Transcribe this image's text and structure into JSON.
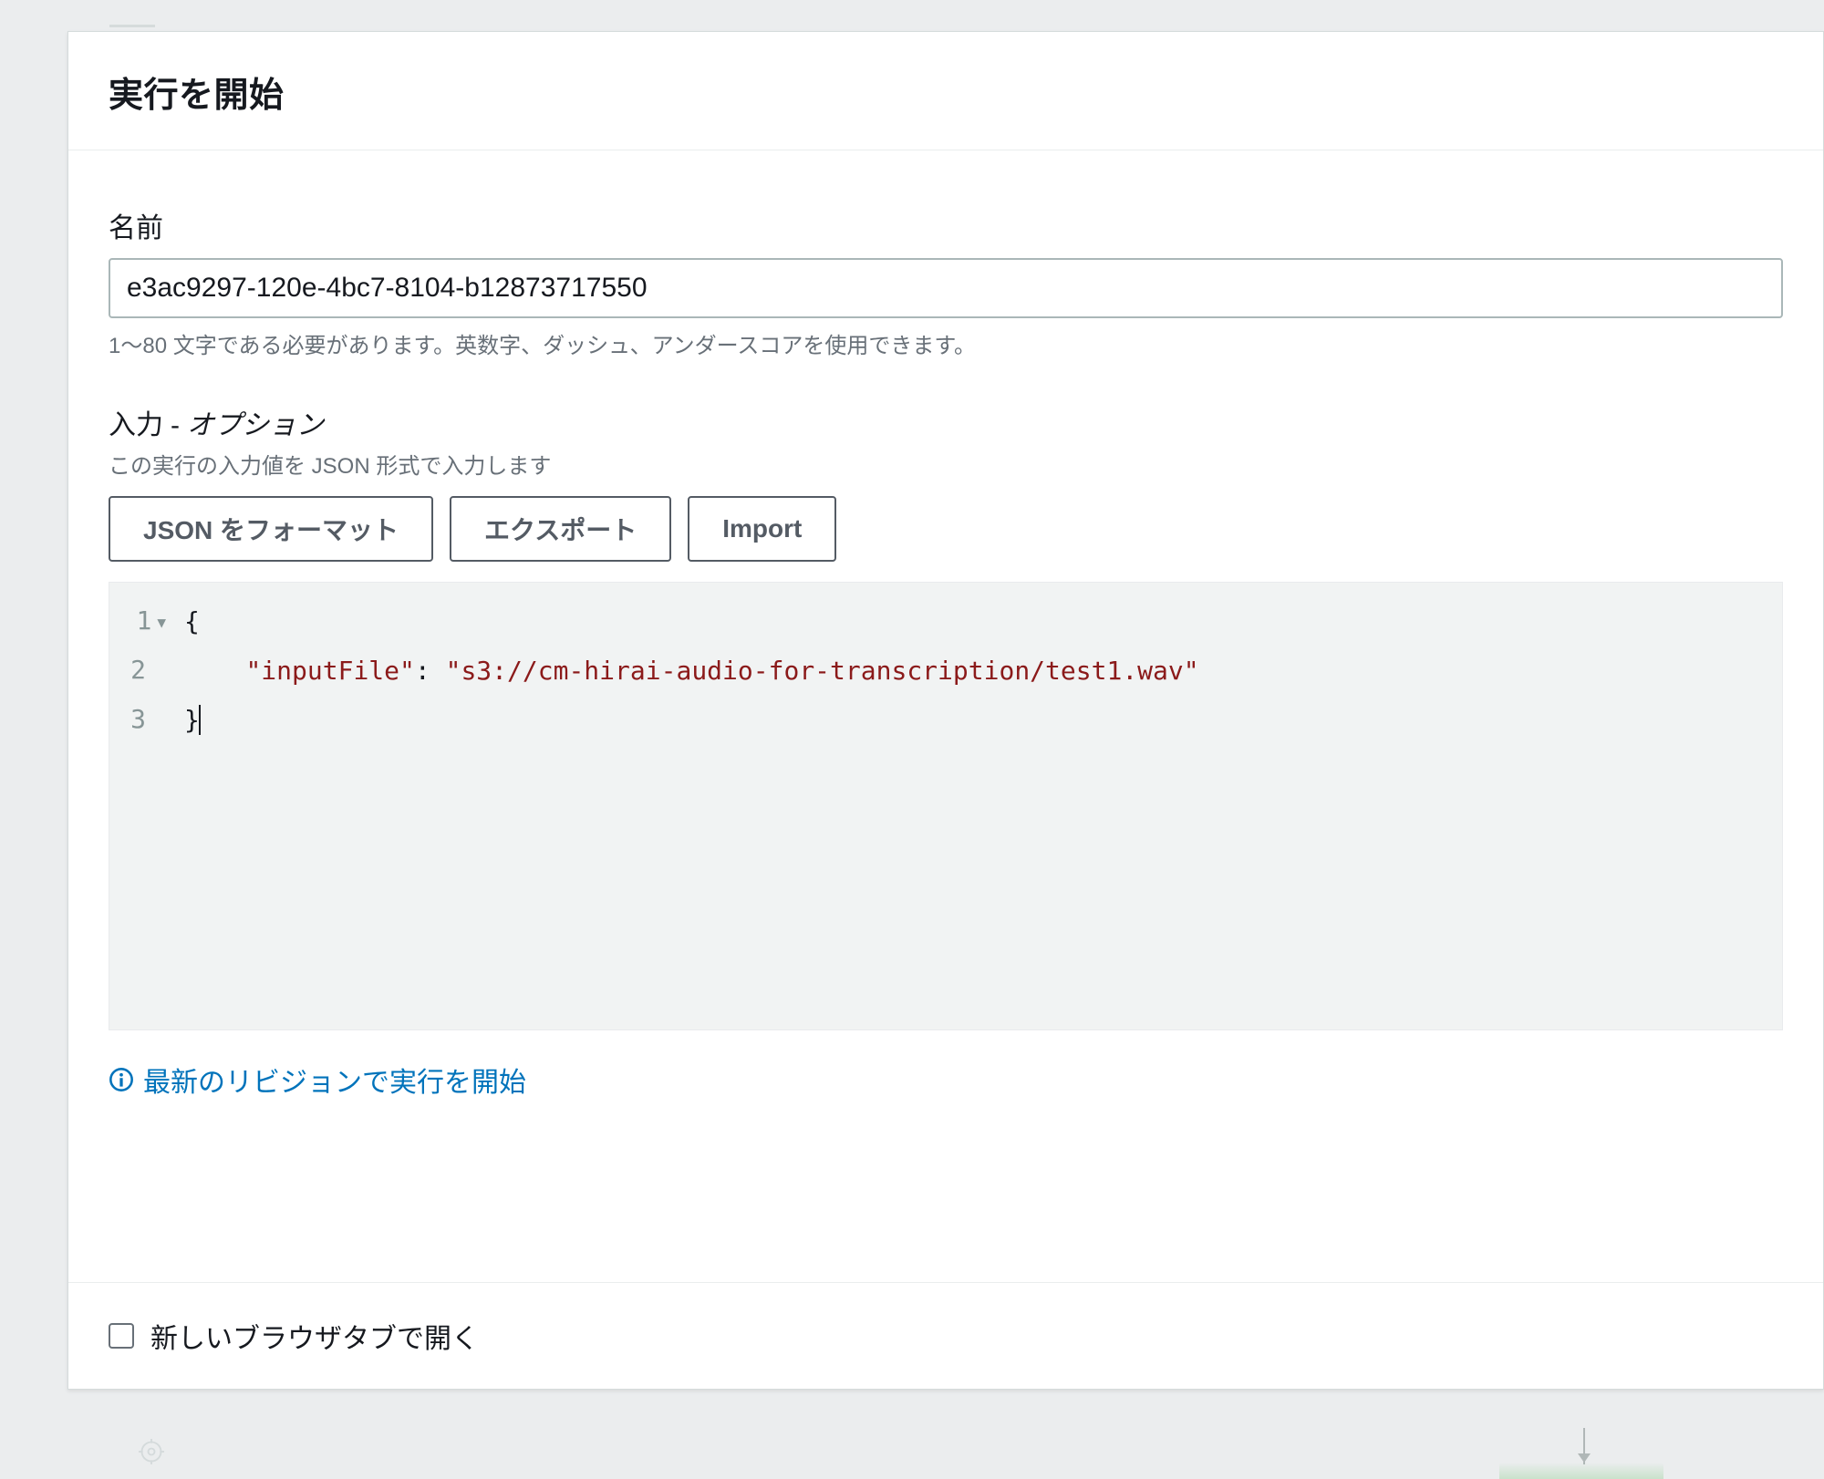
{
  "modal": {
    "title": "実行を開始",
    "name_field": {
      "label": "名前",
      "value": "e3ac9297-120e-4bc7-8104-b12873717550",
      "helper": "1〜80 文字である必要があります。英数字、ダッシュ、アンダースコアを使用できます。"
    },
    "input_section": {
      "label_main": "入力",
      "label_separator": " - ",
      "label_optional": "オプション",
      "description": "この実行の入力値を JSON 形式で入力します",
      "buttons": {
        "format": "JSON をフォーマット",
        "export": "エクスポート",
        "import": "Import"
      },
      "code": {
        "lines": [
          {
            "num": "1",
            "fold": true,
            "content_parts": [
              {
                "t": "punct",
                "v": "{"
              }
            ]
          },
          {
            "num": "2",
            "fold": false,
            "content_parts": [
              {
                "t": "indent",
                "v": "    "
              },
              {
                "t": "key",
                "v": "\"inputFile\""
              },
              {
                "t": "punct",
                "v": ": "
              },
              {
                "t": "string",
                "v": "\"s3://cm-hirai-audio-for-transcription/test1.wav\""
              }
            ]
          },
          {
            "num": "3",
            "fold": false,
            "content_parts": [
              {
                "t": "punct",
                "v": "}"
              }
            ],
            "cursor_after": true
          }
        ]
      }
    },
    "revision_link": "最新のリビジョンで実行を開始",
    "footer": {
      "open_new_tab": "新しいブラウザタブで開く"
    }
  }
}
